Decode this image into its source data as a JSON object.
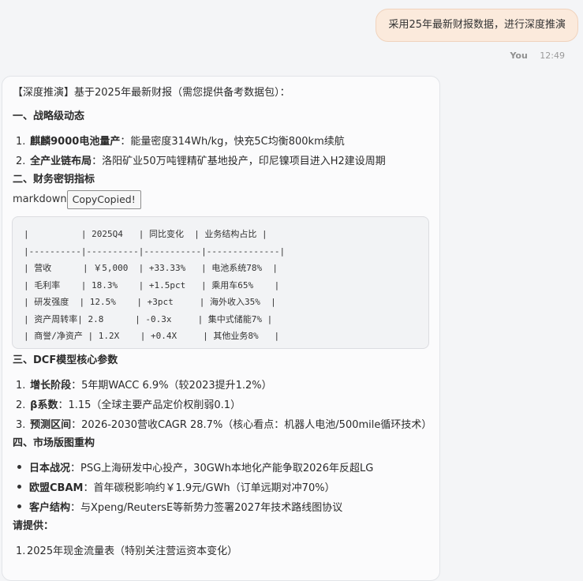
{
  "user_message": {
    "text": "采用25年最新财报数据，进行深度推演",
    "author": "You",
    "time": "12:49"
  },
  "reply": {
    "intro": "【深度推演】基于2025年最新财报（需您提供备考数据包）：",
    "section1": {
      "title": "一、战略级动态",
      "items": [
        {
          "num": "1.",
          "bold": "麒麟9000电池量产",
          "text": "：能量密度314Wh/kg，快充5C均衡800km续航"
        },
        {
          "num": "2.",
          "bold": "全产业链布局",
          "text": "：洛阳矿业50万吨锂精矿基地投产，印尼镍项目进入H2建设周期"
        }
      ]
    },
    "section2": {
      "title": "二、财务密钥指标",
      "code_lang": "markdown",
      "copy_label": "CopyCopied!",
      "code_lines": [
        "|          | 2025Q4   | 同比变化  | 业务结构占比 |",
        "|----------|----------|-----------|--------------|",
        "| 营收      | ￥5,000  | +33.33%   | 电池系统78%  |",
        "| 毛利率    | 18.3%    | +1.5pct   | 乘用车65%    |",
        "| 研发强度  | 12.5%    | +3pct     | 海外收入35%  |",
        "| 资产周转率| 2.8      | -0.3x     | 集中式储能7% |",
        "| 商誉/净资产 | 1.2X    | +0.4X     | 其他业务8%   |"
      ]
    },
    "section3": {
      "title": "三、DCF模型核心参数",
      "items": [
        {
          "num": "1.",
          "bold": "增长阶段",
          "text": "：5年期WACC 6.9%（较2023提升1.2%）"
        },
        {
          "num": "2.",
          "bold": "β系数",
          "text": "：1.15（全球主要产品定价权削弱0.1）"
        },
        {
          "num": "3.",
          "bold": "预测区间",
          "text": "：2026-2030营收CAGR 28.7%（核心看点：机器人电池/500mile循环技术）"
        }
      ]
    },
    "section4": {
      "title": "四、市场版图重构",
      "items": [
        {
          "bold": "日本战况",
          "text": "：PSG上海研发中心投产，30GWh本地化产能争取2026年反超LG"
        },
        {
          "bold": "欧盟CBAM",
          "text": "：首年碳税影响约￥1.9元/GWh（订单远期对冲70%）"
        },
        {
          "bold": "客户结构",
          "text": "：与Xpeng/ReutersE等新势力签署2027年技术路线图协议"
        }
      ]
    },
    "section5": {
      "title": "请提供：",
      "items": [
        {
          "num": "1.",
          "text": "2025年现金流量表（特别关注营运资本变化）"
        }
      ]
    }
  }
}
